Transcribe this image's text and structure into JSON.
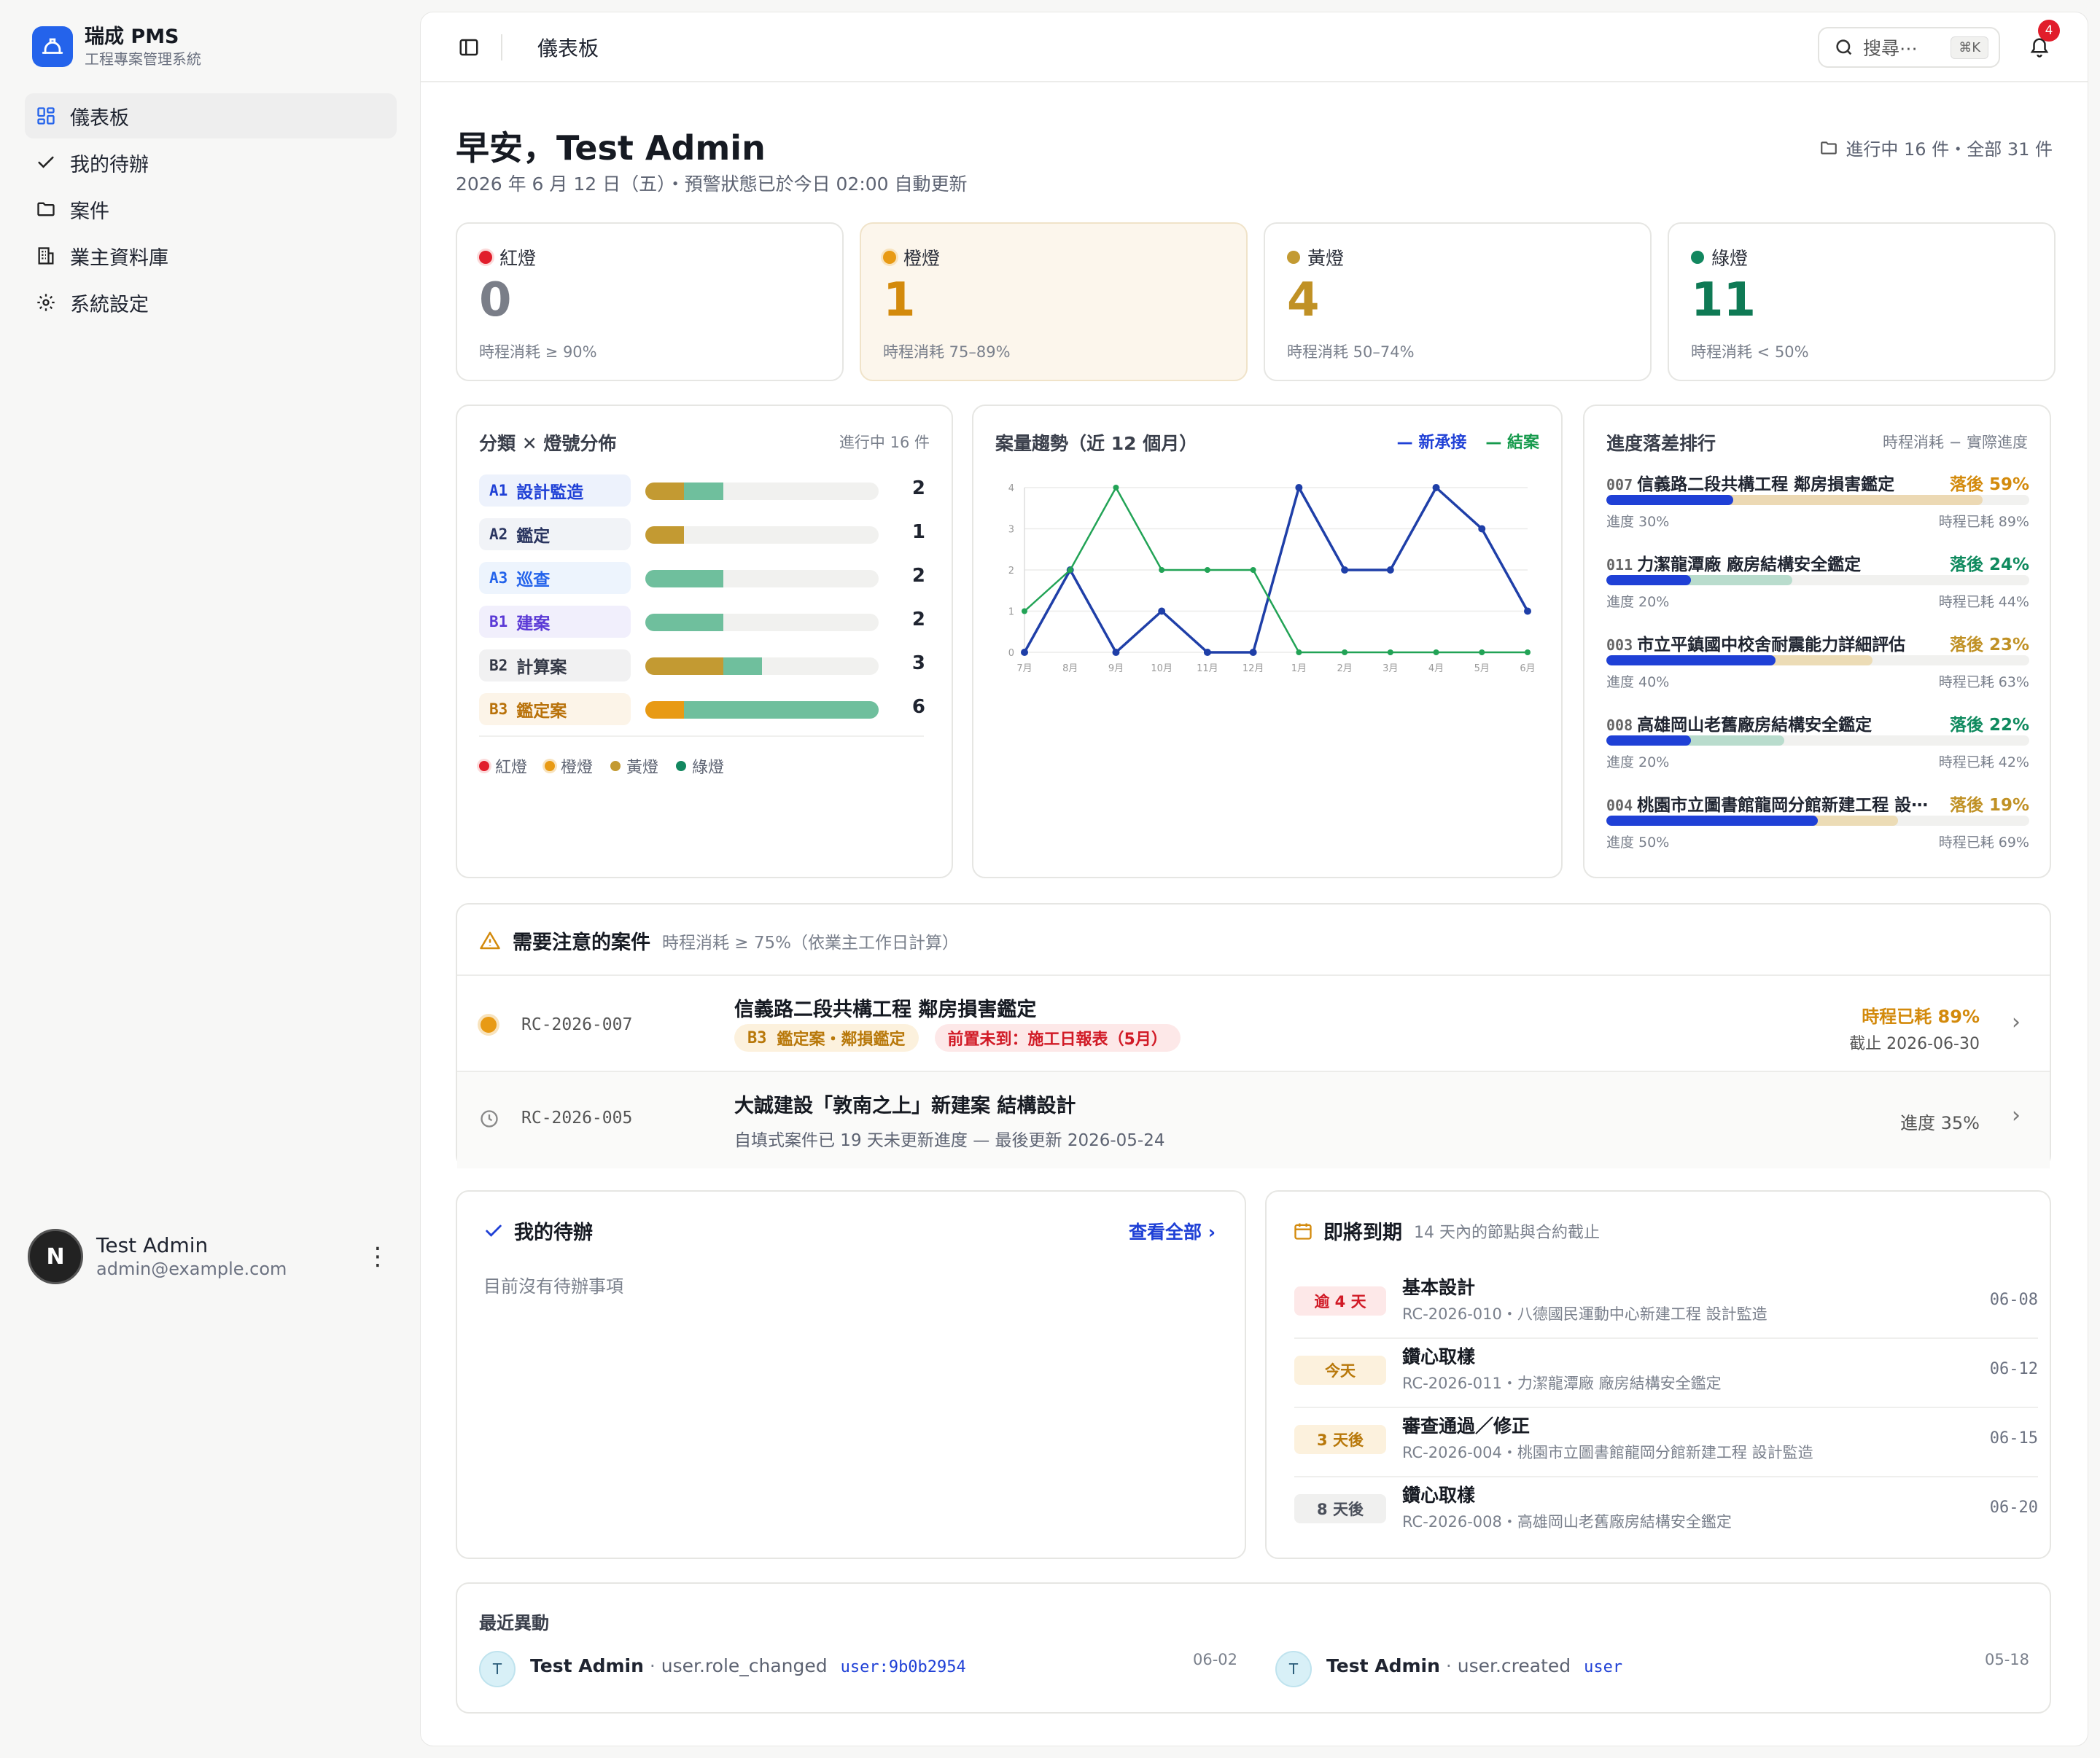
{
  "brand": {
    "name": "瑞成 PMS",
    "subtitle": "工程專案管理系統"
  },
  "nav": [
    {
      "label": "儀表板",
      "icon": "dashboard-icon",
      "active": true
    },
    {
      "label": "我的待辦",
      "icon": "check-icon",
      "active": false
    },
    {
      "label": "案件",
      "icon": "folder-icon",
      "active": false
    },
    {
      "label": "業主資料庫",
      "icon": "building-icon",
      "active": false
    },
    {
      "label": "系統設定",
      "icon": "gear-icon",
      "active": false
    }
  ],
  "user": {
    "initial": "N",
    "name": "Test Admin",
    "email": "admin@example.com"
  },
  "topbar": {
    "title": "儀表板",
    "search_label": "搜尋⋯",
    "shortcut": "⌘K",
    "notify_count": "4"
  },
  "header": {
    "greeting": "早安，Test Admin",
    "date_line": "2026 年 6 月 12 日（五）・預警狀態已於今日 02:00 自動更新",
    "project_count": "進行中 16 件・全部 31 件"
  },
  "lights": [
    {
      "label": "紅燈",
      "value": "0",
      "note": "時程消耗 ≥ 90%",
      "dot": "#e11d2b",
      "color": "#7a7e88"
    },
    {
      "label": "橙燈",
      "value": "1",
      "note": "時程消耗 75–89%",
      "dot": "#e89a14",
      "color": "#d38a0c"
    },
    {
      "label": "黃燈",
      "value": "4",
      "note": "時程消耗 50–74%",
      "dot": "#c39a32",
      "color": "#c09125"
    },
    {
      "label": "綠燈",
      "value": "11",
      "note": "時程消耗 < 50%",
      "dot": "#12875f",
      "color": "#0f7a55"
    }
  ],
  "categories": {
    "title": "分類 ✕ 燈號分佈",
    "count": "進行中 16 件",
    "rows": [
      {
        "code": "A1",
        "label": "設計監造",
        "count": "2",
        "tag_bg": "#edf2fc",
        "tag_fg": "#1f40d6",
        "yellow": 1,
        "green": 1
      },
      {
        "code": "A2",
        "label": "鑑定",
        "count": "1",
        "tag_bg": "#f1f3f7",
        "tag_fg": "#2a3560",
        "yellow": 1,
        "green": 0
      },
      {
        "code": "A3",
        "label": "巡查",
        "count": "2",
        "tag_bg": "#edf4fd",
        "tag_fg": "#2463eb",
        "yellow": 0,
        "green": 2
      },
      {
        "code": "B1",
        "label": "建案",
        "count": "2",
        "tag_bg": "#f1effc",
        "tag_fg": "#5b3ad6",
        "yellow": 0,
        "green": 2
      },
      {
        "code": "B2",
        "label": "計算案",
        "count": "3",
        "tag_bg": "#f1f1f2",
        "tag_fg": "#333846",
        "yellow": 2,
        "green": 1
      },
      {
        "code": "B3",
        "label": "鑑定案",
        "count": "6",
        "tag_bg": "#fcf4e8",
        "tag_fg": "#b9720a",
        "orange": 1,
        "green": 5
      }
    ],
    "legend": [
      "紅燈",
      "橙燈",
      "黃燈",
      "綠燈"
    ]
  },
  "trend": {
    "title": "案量趨勢（近 12 個月）",
    "legend_new": "— 新承接",
    "legend_closed": "— 結案"
  },
  "chart_data": {
    "type": "line",
    "x": [
      "7月",
      "8月",
      "9月",
      "10月",
      "11月",
      "12月",
      "1月",
      "2月",
      "3月",
      "4月",
      "5月",
      "6月"
    ],
    "series": [
      {
        "name": "新承接",
        "color": "#1f3fa8",
        "values": [
          0,
          2,
          0,
          1,
          0,
          0,
          4,
          2,
          2,
          4,
          3,
          1
        ]
      },
      {
        "name": "結案",
        "color": "#22a356",
        "values": [
          1,
          2,
          4,
          2,
          2,
          2,
          0,
          0,
          0,
          0,
          0,
          0
        ]
      }
    ],
    "y_ticks": [
      "0",
      "1",
      "2",
      "3",
      "4"
    ],
    "ylim": [
      0,
      4
    ],
    "grid": true
  },
  "lag": {
    "title": "進度落差排行",
    "subtitle": "時程消耗 − 實際進度",
    "items": [
      {
        "code": "007",
        "name": "信義路二段共構工程 鄰房損害鑑定",
        "lag": "落後 59%",
        "progress": 30,
        "consumed": 89,
        "progress_label": "進度 30%",
        "consumed_label": "時程已耗 89%",
        "lag_color": "#d38a0c",
        "plan_color": "#ecd9b4"
      },
      {
        "code": "011",
        "name": "力潔龍潭廠 廠房結構安全鑑定",
        "lag": "落後 24%",
        "progress": 20,
        "consumed": 44,
        "progress_label": "進度 20%",
        "consumed_label": "時程已耗 44%",
        "lag_color": "#0f8a5e",
        "plan_color": "#b9dccd"
      },
      {
        "code": "003",
        "name": "市立平鎮國中校舍耐震能力詳細評估",
        "lag": "落後 23%",
        "progress": 40,
        "consumed": 63,
        "progress_label": "進度 40%",
        "consumed_label": "時程已耗 63%",
        "lag_color": "#c09125",
        "plan_color": "#ecdcb6"
      },
      {
        "code": "008",
        "name": "高雄岡山老舊廠房結構安全鑑定",
        "lag": "落後 22%",
        "progress": 20,
        "consumed": 42,
        "progress_label": "進度 20%",
        "consumed_label": "時程已耗 42%",
        "lag_color": "#0f8a5e",
        "plan_color": "#b9dccd"
      },
      {
        "code": "004",
        "name": "桃園市立圖書館龍岡分館新建工程 設⋯",
        "lag": "落後 19%",
        "progress": 50,
        "consumed": 69,
        "progress_label": "進度 50%",
        "consumed_label": "時程已耗 69%",
        "lag_color": "#c09125",
        "plan_color": "#ecdcb6"
      }
    ]
  },
  "attention": {
    "title": "需要注意的案件",
    "subtitle": "時程消耗 ≥ 75%（依業主工作日計算）",
    "rows": [
      {
        "code": "RC-2026-007",
        "name": "信義路二段共構工程 鄰房損害鑑定",
        "tag1_code": "B3",
        "tag1": "鑑定案・鄰損鑑定",
        "tag2": "前置未到：施工日報表（5月）",
        "right1": "時程已耗 89%",
        "right2": "截止 2026-06-30"
      },
      {
        "code": "RC-2026-005",
        "name": "大誠建設「敦南之上」新建案 結構設計",
        "sub": "自填式案件已 19 天未更新進度 — 最後更新 2026-05-24",
        "right1": "進度 35%"
      }
    ]
  },
  "todo": {
    "title": "我的待辦",
    "view_all": "查看全部",
    "empty": "目前沒有待辦事項"
  },
  "due": {
    "title": "即將到期",
    "subtitle": "14 天內的節點與合約截止",
    "rows": [
      {
        "badge": "逾 4 天",
        "title": "基本設計",
        "sub": "RC-2026-010・八德國民運動中心新建工程 設計監造",
        "date": "06-08",
        "bg": "#fde8e8",
        "fg": "#d11a26"
      },
      {
        "badge": "今天",
        "title": "鑽心取樣",
        "sub": "RC-2026-011・力潔龍潭廠 廠房結構安全鑑定",
        "date": "06-12",
        "bg": "#fcf1dd",
        "fg": "#b8780a"
      },
      {
        "badge": "3 天後",
        "title": "審查通過／修正",
        "sub": "RC-2026-004・桃園市立圖書館龍岡分館新建工程 設計監造",
        "date": "06-15",
        "bg": "#fcf1dd",
        "fg": "#b8780a"
      },
      {
        "badge": "8 天後",
        "title": "鑽心取樣",
        "sub": "RC-2026-008・高雄岡山老舊廠房結構安全鑑定",
        "date": "06-20",
        "bg": "#f0f0ef",
        "fg": "#4a4f5a"
      }
    ]
  },
  "activity": {
    "title": "最近異動",
    "items": [
      {
        "initial": "T",
        "actor": "Test Admin",
        "action": "user.role_changed",
        "target": "user:9b0b2954",
        "date": "06-02"
      },
      {
        "initial": "T",
        "actor": "Test Admin",
        "action": "user.created",
        "target": "user",
        "date": "05-18"
      }
    ]
  }
}
